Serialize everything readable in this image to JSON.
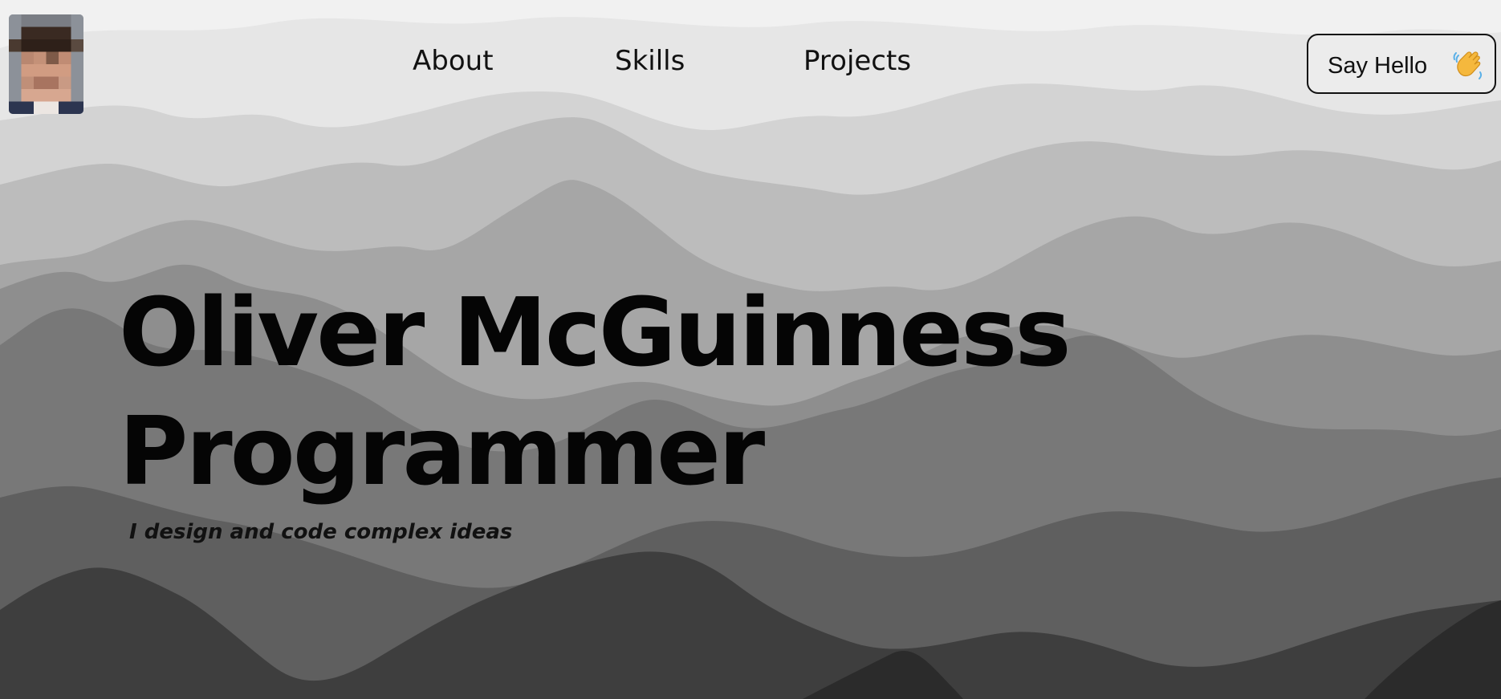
{
  "profile": {
    "avatar_icon": "profile-photo-pixelated"
  },
  "nav": {
    "items": [
      {
        "label": "About"
      },
      {
        "label": "Skills"
      },
      {
        "label": "Projects"
      }
    ]
  },
  "cta": {
    "label": "Say Hello",
    "icon": "waving-hand-icon"
  },
  "hero": {
    "name": "Oliver McGuinness",
    "role": "Programmer",
    "tagline": "I design and code complex ideas"
  },
  "theme": {
    "text_color": "#111111",
    "background": "#f0f0f0",
    "mountain_tones": [
      "#d8d8d8",
      "#c4c4c4",
      "#a8a8a8",
      "#8e8e8e",
      "#777777",
      "#5e5e5e",
      "#3c3c3c",
      "#2a2a2a"
    ]
  }
}
